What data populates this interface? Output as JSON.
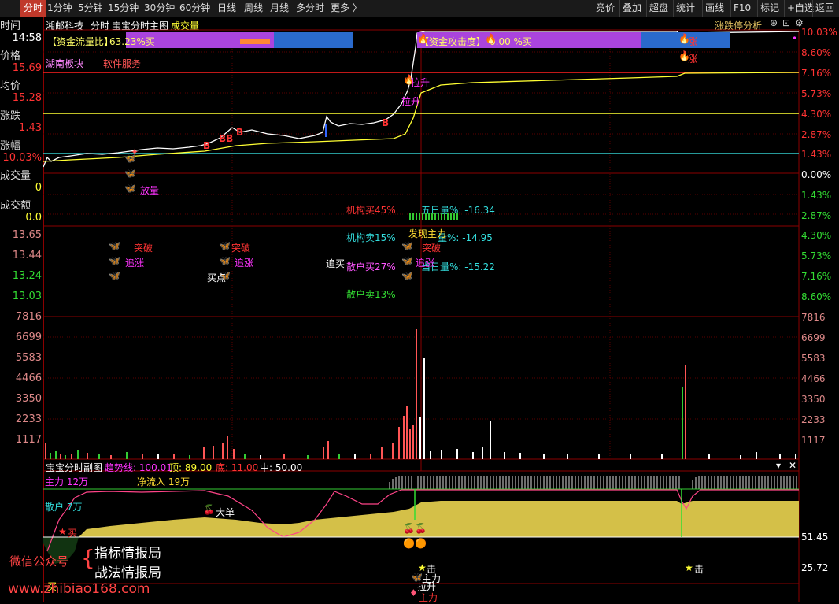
{
  "topbar": {
    "tabs": [
      "分时",
      "1分钟",
      "5分钟",
      "15分钟",
      "30分钟",
      "60分钟",
      "日线",
      "周线",
      "月线",
      "多分时",
      "更多 〉"
    ],
    "right_buttons": [
      "竞价",
      "叠加",
      "超盘",
      "统计",
      "画线",
      "F10",
      "标记",
      "+自选",
      "返回"
    ]
  },
  "header": {
    "stock": "湘邮科技",
    "mode": "分时",
    "chart_name": "宝宝分时主图",
    "volume_label": "成交量",
    "right_label": "涨跌停分析"
  },
  "left": {
    "time_label": "时间",
    "time_value": "14:58",
    "price_label": "价格",
    "price_value": "15.69",
    "avg_label": "均价",
    "avg_value": "15.28",
    "change_label": "涨跌",
    "change_value": "1.43",
    "pct_label": "涨幅",
    "pct_value": "10.03%",
    "vol_label": "成交量",
    "vol_value": "0",
    "amt_label": "成交额",
    "amt_value": "0.0"
  },
  "right_axis": [
    "10.03%",
    "8.60%",
    "7.16%",
    "5.73%",
    "4.30%",
    "2.87%",
    "1.43%",
    "0.00%",
    "1.43%",
    "2.87%",
    "4.30%",
    "5.73%",
    "7.16%",
    "8.60%"
  ],
  "left_axis": [
    "13.65",
    "13.44",
    "13.24",
    "13.03"
  ],
  "vol_axis": [
    "7816",
    "6699",
    "5583",
    "4466",
    "3350",
    "2233",
    "1117"
  ],
  "indicators": {
    "flow_label": "【资金流量比】",
    "flow_value": "63.23%买",
    "attack_label": "【资金攻击度】",
    "attack_value": "0.00 %买",
    "sector": "湖南板块",
    "industry": "软件服务"
  },
  "stats": {
    "inst_buy": "机构买45%",
    "inst_sell": "机构卖15%",
    "retail_buy": "散户买27%",
    "retail_sell": "散户卖13%",
    "five_day": "五日量%:  -16.34",
    "day_amount": "量%:  -14.95",
    "cur_day": "当日量%:  -15.22",
    "chase_buy": "追买",
    "launch": "发现主力"
  },
  "signals": {
    "breakout": "突破",
    "chase": "追涨",
    "buy_point": "买点",
    "release_vol": "放量",
    "pull_up": "拉升",
    "rise": "涨"
  },
  "sub": {
    "title": "宝宝分时副图",
    "trend": "趋势线: 100.01",
    "top": "顶: 89.00",
    "bottom": "底: 11.00",
    "mid": "中: 50.00",
    "main_force": "主力  12万",
    "net_inflow": "净流入 19万",
    "retail": "散户  7万",
    "big_order": "大单",
    "buy": "买",
    "hit": "击",
    "axis_hi": "51.45",
    "axis_lo": "25.72",
    "main_label": "主力",
    "pull": "拉升",
    "sell_small": "买"
  },
  "watermark": {
    "wechat": "微信公众号",
    "line1": "指标情报局",
    "line2": "战法情报局",
    "url": "www.zhibiao168.com"
  },
  "chart_data": {
    "type": "line",
    "title": "宝宝分时主图",
    "price_close": 15.69,
    "avg_price": 15.28,
    "change": 1.43,
    "change_pct": 10.03,
    "volume_axis_ticks": [
      1117,
      2233,
      3350,
      4466,
      5583,
      6699,
      7816
    ]
  }
}
